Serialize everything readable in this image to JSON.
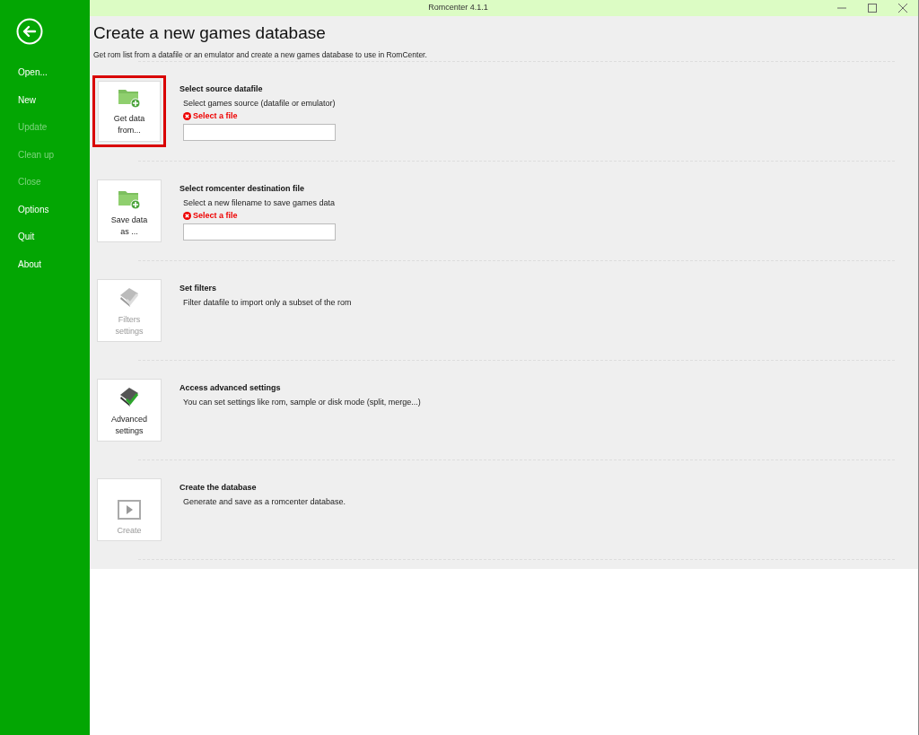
{
  "window": {
    "title": "Romcenter 4.1.1"
  },
  "sidebar": {
    "items": [
      {
        "label": "Open...",
        "disabled": false
      },
      {
        "label": "New",
        "disabled": false
      },
      {
        "label": "Update",
        "disabled": true
      },
      {
        "label": "Clean up",
        "disabled": true
      },
      {
        "label": "Close",
        "disabled": true
      },
      {
        "label": "Options",
        "disabled": false
      },
      {
        "label": "Quit",
        "disabled": false
      },
      {
        "label": "About",
        "disabled": false
      }
    ]
  },
  "page": {
    "title": "Create a new games database",
    "subtitle": "Get rom list from a datafile or an emulator and create a new games database to use in RomCenter."
  },
  "steps": [
    {
      "kind": "folder",
      "button": "Get data from...",
      "disabled": false,
      "focused": true,
      "heading": "Select source datafile",
      "description": "Select games source (datafile or emulator)",
      "error": "Select a file",
      "has_field": true
    },
    {
      "kind": "folder",
      "button": "Save data as ...",
      "disabled": false,
      "focused": false,
      "heading": "Select romcenter destination file",
      "description": "Select a new filename to save games data",
      "error": "Select a file",
      "has_field": true
    },
    {
      "kind": "filter",
      "button": "Filters settings",
      "disabled": true,
      "focused": false,
      "heading": "Set filters",
      "description": "Filter datafile to import only a subset of the rom"
    },
    {
      "kind": "filter",
      "button": "Advanced settings",
      "disabled": false,
      "focused": false,
      "heading": "Access advanced settings",
      "description": "You can set settings like rom, sample or disk mode (split, merge...)"
    },
    {
      "kind": "play",
      "button": "Create",
      "disabled": true,
      "focused": false,
      "heading": "Create the database",
      "description": "Generate and save as a romcenter database."
    }
  ]
}
